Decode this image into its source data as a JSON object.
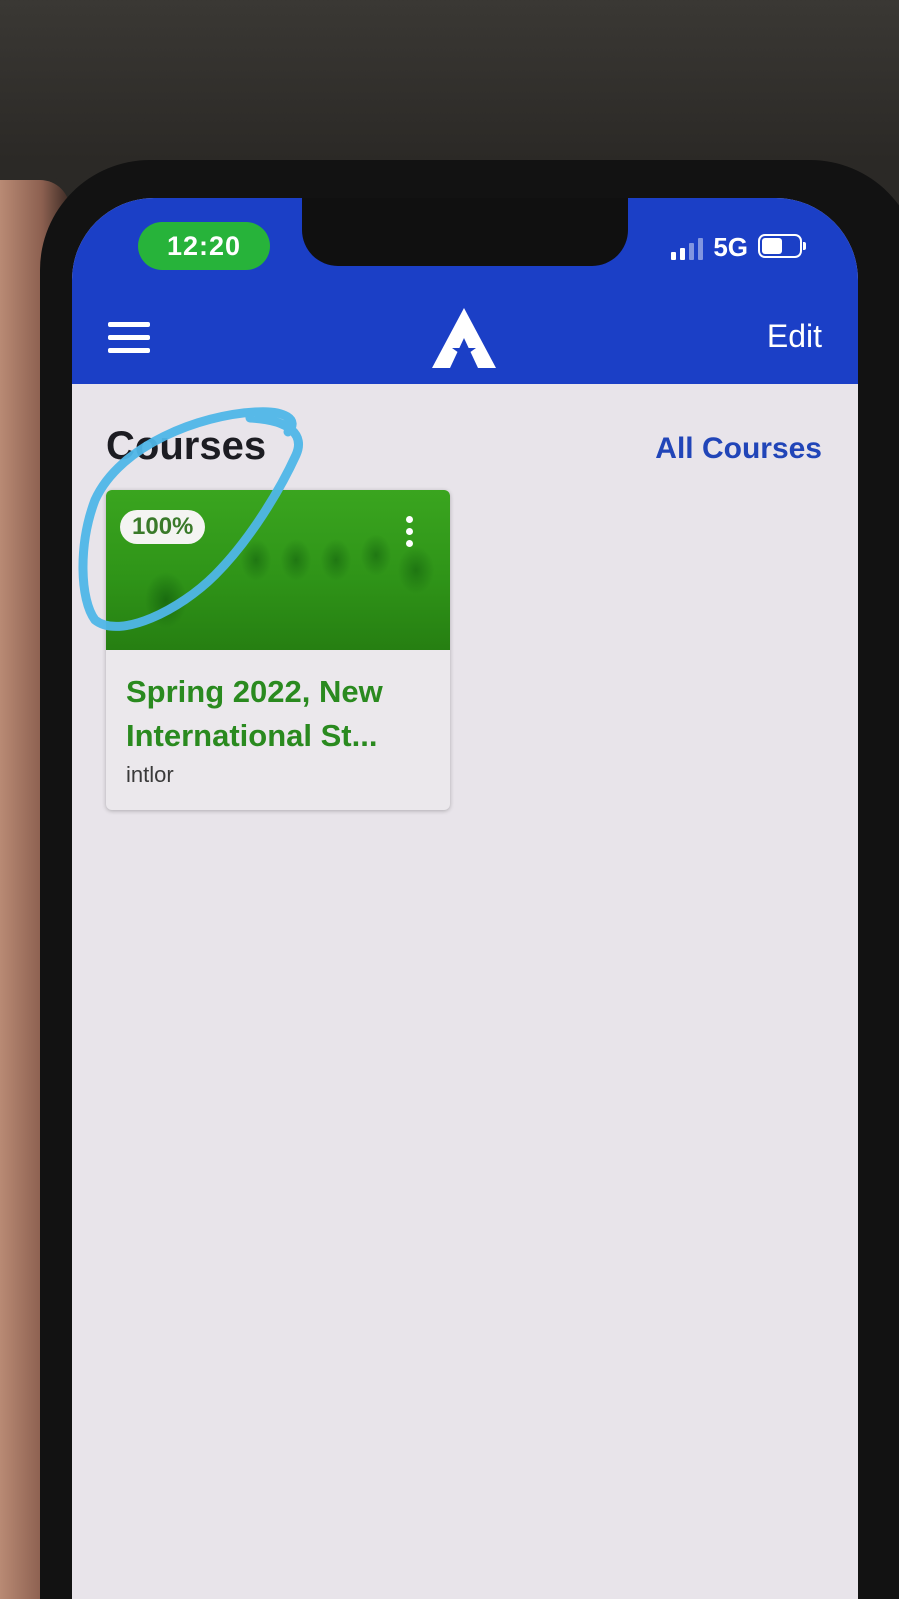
{
  "status_bar": {
    "time": "12:20",
    "network": "5G",
    "battery_level": 0.55
  },
  "header": {
    "menu_icon": "hamburger-menu-icon",
    "logo_icon": "star-a-logo-icon",
    "edit_label": "Edit",
    "accent_color": "#1b3fc6"
  },
  "courses": {
    "title": "Courses",
    "all_courses_label": "All Courses",
    "cards": [
      {
        "progress": "100%",
        "title_line1": "Spring 2022, New",
        "title_line2": "International St...",
        "subtitle": "intlor",
        "color": "#2a8a1f"
      }
    ]
  }
}
